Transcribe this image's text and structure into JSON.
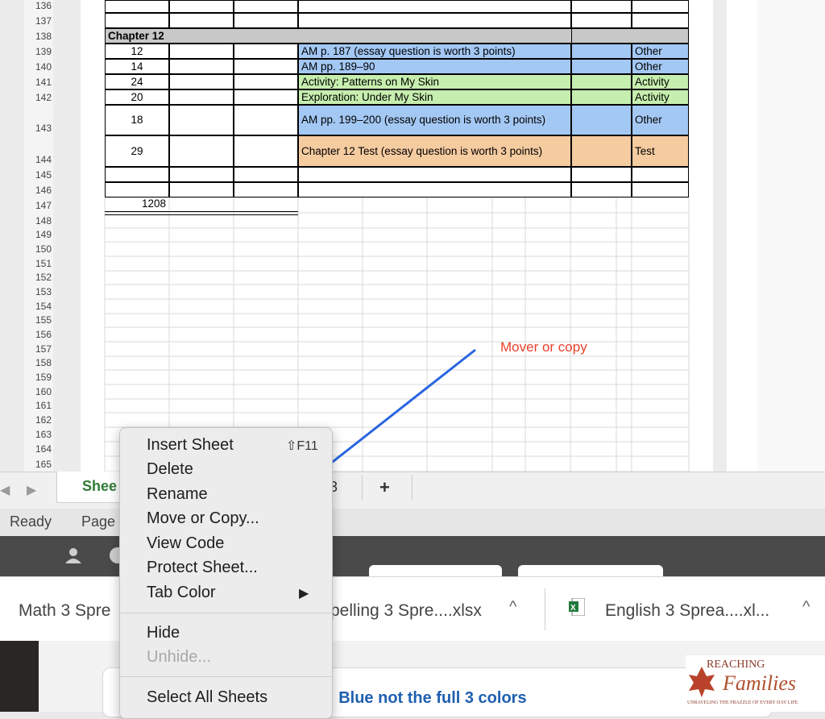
{
  "rows": [
    {
      "num": "136"
    },
    {
      "num": "137"
    },
    {
      "num": "138"
    },
    {
      "num": "139"
    },
    {
      "num": "140"
    },
    {
      "num": "141"
    },
    {
      "num": "142"
    },
    {
      "num": "143"
    },
    {
      "num": "144"
    },
    {
      "num": "145"
    },
    {
      "num": "146"
    },
    {
      "num": "147"
    },
    {
      "num": "148"
    },
    {
      "num": "149"
    },
    {
      "num": "150"
    },
    {
      "num": "151"
    },
    {
      "num": "152"
    },
    {
      "num": "153"
    },
    {
      "num": "154"
    },
    {
      "num": "155"
    },
    {
      "num": "156"
    },
    {
      "num": "157"
    },
    {
      "num": "158"
    },
    {
      "num": "159"
    },
    {
      "num": "160"
    },
    {
      "num": "161"
    },
    {
      "num": "162"
    },
    {
      "num": "163"
    },
    {
      "num": "164"
    },
    {
      "num": "165"
    }
  ],
  "table": {
    "chapter_header": "Chapter 12",
    "entries": [
      {
        "points": "12",
        "description": "AM p. 187 (essay question is worth 3 points)",
        "type": "Other",
        "color": "#a4c8f4"
      },
      {
        "points": "14",
        "description": "AM pp. 189–90",
        "type": "Other",
        "color": "#a4c8f4"
      },
      {
        "points": "24",
        "description": "Activity: Patterns on My Skin",
        "type": "Activity",
        "color": "#c6eeae"
      },
      {
        "points": "20",
        "description": "Exploration: Under My Skin",
        "type": "Activity",
        "color": "#c6eeae"
      },
      {
        "points": "18",
        "description": "AM pp. 199–200 (essay question is worth 3 points)",
        "type": "Other",
        "color": "#a4c8f4"
      },
      {
        "points": "29",
        "description": "Chapter 12 Test (essay question is worth 3 points)",
        "type": "Test",
        "color": "#f5cba0"
      }
    ],
    "total": "1208"
  },
  "annotation": {
    "text": "Mover or copy",
    "color": "#e8412b",
    "arrow_color": "#2a66e0"
  },
  "tabs": {
    "active_tab": "Shee",
    "other_tab": "3",
    "add_label": "+"
  },
  "status": {
    "ready": "Ready",
    "page": "Page"
  },
  "context_menu": {
    "items": [
      {
        "label": "Insert Sheet",
        "shortcut": "⇧F11"
      },
      {
        "label": "Delete"
      },
      {
        "label": "Rename"
      },
      {
        "label": "Move or Copy..."
      },
      {
        "label": "View Code"
      },
      {
        "label": "Protect Sheet..."
      },
      {
        "label": "Tab Color",
        "submenu": "▶"
      },
      {
        "label": "Hide"
      },
      {
        "label": "Unhide..."
      },
      {
        "label": "Select All Sheets"
      }
    ]
  },
  "downloads": [
    {
      "name": "Math 3 Spre"
    },
    {
      "name": "pelling 3 Spre....xlsx"
    },
    {
      "name": "English 3 Sprea....xl..."
    }
  ],
  "bottom": {
    "text": ": Blue not the full 3 colors"
  },
  "logo": {
    "line1": "REACHING",
    "line2": "Families",
    "tagline": "UNRAVELING THE FRAZZLE OF EVERY DAY LIFE"
  }
}
